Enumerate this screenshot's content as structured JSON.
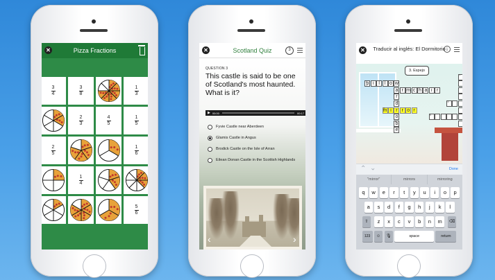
{
  "phone1": {
    "title": "Pizza Fractions",
    "cells": [
      {
        "type": "frac",
        "n": "3",
        "d": "4"
      },
      {
        "type": "frac",
        "n": "3",
        "d": "8"
      },
      {
        "type": "pie",
        "slices": 8,
        "filled": 6
      },
      {
        "type": "frac",
        "n": "1",
        "d": "3"
      },
      {
        "type": "pie",
        "slices": 6,
        "filled": 2
      },
      {
        "type": "frac",
        "n": "2",
        "d": "3"
      },
      {
        "type": "frac",
        "n": "4",
        "d": "5"
      },
      {
        "type": "frac",
        "n": "1",
        "d": "5"
      },
      {
        "type": "frac",
        "n": "2",
        "d": "5"
      },
      {
        "type": "pie",
        "slices": 5,
        "filled": 4
      },
      {
        "type": "pie",
        "slices": 3,
        "filled": 1
      },
      {
        "type": "frac",
        "n": "1",
        "d": "6"
      },
      {
        "type": "pie",
        "slices": 4,
        "filled": 1
      },
      {
        "type": "frac",
        "n": "1",
        "d": "4"
      },
      {
        "type": "pie",
        "slices": 5,
        "filled": 2
      },
      {
        "type": "pie",
        "slices": 8,
        "filled": 3
      },
      {
        "type": "pie",
        "slices": 6,
        "filled": 1
      },
      {
        "type": "pie",
        "slices": 6,
        "filled": 5
      },
      {
        "type": "pie",
        "slices": 3,
        "filled": 2
      },
      {
        "type": "frac",
        "n": "5",
        "d": "6"
      }
    ]
  },
  "phone2": {
    "title": "Scotland Quiz",
    "progress": "3",
    "question_number": "QUESTION 3",
    "question": "This castle is said to be one of Scotland's most haunted. What is it?",
    "audio_start": "00:00",
    "audio_end": "00:17",
    "options": [
      {
        "label": "Fyvie Castle near Aberdeen",
        "selected": false
      },
      {
        "label": "Glamis Castle in Angus",
        "selected": true
      },
      {
        "label": "Brodick Castle on the Isle of Arran",
        "selected": false
      },
      {
        "label": "Eilean Donan Castle in the Scottish Highlands",
        "selected": false
      }
    ]
  },
  "phone3": {
    "title": "Traducir al inglés: El Dormitorio",
    "clue": "3. Espejo",
    "done_label": "Done",
    "suggestions": [
      "\"mirror\"",
      "mirrors",
      "mirroring"
    ],
    "keyboard_rows": [
      [
        "q",
        "w",
        "e",
        "r",
        "t",
        "y",
        "u",
        "i",
        "o",
        "p"
      ],
      [
        "a",
        "s",
        "d",
        "f",
        "g",
        "h",
        "j",
        "k",
        "l"
      ]
    ],
    "keyboard_row3": [
      "z",
      "x",
      "c",
      "v",
      "b",
      "n",
      "m"
    ],
    "key_123": "123",
    "key_space": "space",
    "key_return": "return",
    "crossword": [
      {
        "r": 2,
        "c": 1,
        "ch": "p",
        "n": "2"
      },
      {
        "r": 2,
        "c": 2,
        "ch": "i"
      },
      {
        "r": 2,
        "c": 3,
        "ch": "l"
      },
      {
        "r": 2,
        "c": 4,
        "ch": "l"
      },
      {
        "r": 2,
        "c": 5,
        "ch": "o"
      },
      {
        "r": 2,
        "c": 6,
        "ch": "w"
      },
      {
        "r": 3,
        "c": 6,
        "ch": "a"
      },
      {
        "r": 3,
        "c": 7,
        "ch": "r"
      },
      {
        "r": 3,
        "c": 8,
        "ch": "m"
      },
      {
        "r": 3,
        "c": 9,
        "ch": "c"
      },
      {
        "r": 3,
        "c": 10,
        "ch": "h"
      },
      {
        "r": 3,
        "c": 11,
        "ch": "a"
      },
      {
        "r": 3,
        "c": 12,
        "ch": "i"
      },
      {
        "r": 3,
        "c": 13,
        "ch": "r"
      },
      {
        "r": 4,
        "c": 6,
        "ch": "r"
      },
      {
        "r": 5,
        "c": 6,
        "ch": "d"
      },
      {
        "r": 6,
        "c": 4,
        "ch": "m",
        "hl": true,
        "n": "3"
      },
      {
        "r": 6,
        "c": 5,
        "ch": "i",
        "hl": true
      },
      {
        "r": 6,
        "c": 6,
        "ch": "r",
        "hl": true
      },
      {
        "r": 6,
        "c": 7,
        "ch": "r",
        "hl": true
      },
      {
        "r": 6,
        "c": 8,
        "ch": "o",
        "hl": true
      },
      {
        "r": 6,
        "c": 9,
        "ch": "r",
        "hl": true
      },
      {
        "r": 7,
        "c": 6,
        "ch": "o"
      },
      {
        "r": 8,
        "c": 6,
        "ch": "b",
        "n": "5"
      },
      {
        "r": 9,
        "c": 6,
        "ch": "e"
      },
      {
        "r": 1,
        "c": 17,
        "ch": "",
        "n": "1"
      },
      {
        "r": 2,
        "c": 17,
        "ch": ""
      },
      {
        "r": 3,
        "c": 17,
        "ch": ""
      },
      {
        "r": 4,
        "c": 17,
        "ch": ""
      },
      {
        "r": 5,
        "c": 15,
        "ch": "",
        "n": "4"
      },
      {
        "r": 5,
        "c": 16,
        "ch": ""
      },
      {
        "r": 5,
        "c": 17,
        "ch": ""
      },
      {
        "r": 5,
        "c": 18,
        "ch": ""
      },
      {
        "r": 6,
        "c": 17,
        "ch": ""
      },
      {
        "r": 7,
        "c": 17,
        "ch": ""
      },
      {
        "r": 7,
        "c": 12,
        "ch": "",
        "n": "6"
      },
      {
        "r": 7,
        "c": 13,
        "ch": ""
      },
      {
        "r": 7,
        "c": 14,
        "ch": ""
      },
      {
        "r": 7,
        "c": 15,
        "ch": ""
      },
      {
        "r": 7,
        "c": 16,
        "ch": ""
      },
      {
        "r": 7,
        "c": 17,
        "ch": ""
      },
      {
        "r": 8,
        "c": 17,
        "ch": ""
      }
    ]
  },
  "colors": {
    "quiz_green": "#2f7f3c",
    "fractions_green": "#2e8b47",
    "highlight_yellow": "#ffff26",
    "ios_blue": "#1e7bf2",
    "pizza_sauce": "#c0392b",
    "pizza_cheese": "#e8a23a"
  }
}
